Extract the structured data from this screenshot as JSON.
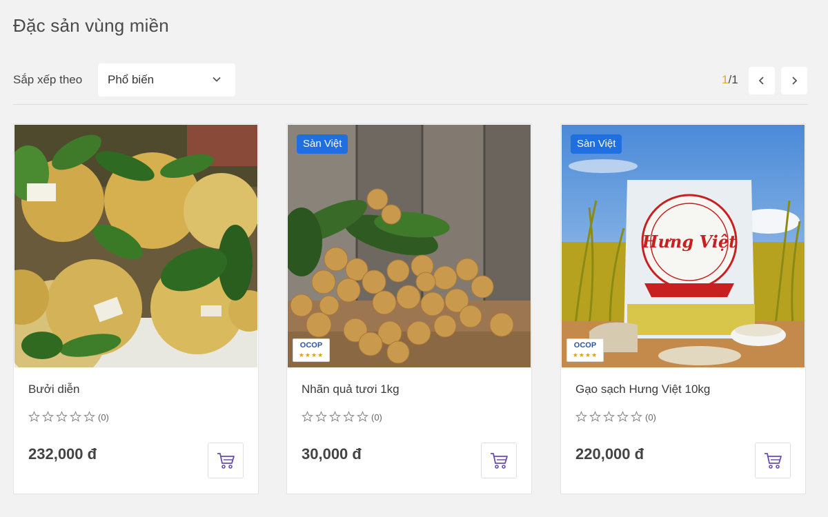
{
  "page_title": "Đặc sản vùng miền",
  "sort": {
    "label": "Sắp xếp theo",
    "selected": "Phổ biến"
  },
  "pagination": {
    "current": "1",
    "total": "/1"
  },
  "products": [
    {
      "name": "Bưởi diễn",
      "price": "232,000 đ",
      "rating_count": "(0)",
      "rating": 0,
      "badge": "",
      "ocop": false,
      "image": "pomelo-photo"
    },
    {
      "name": "Nhãn quả tươi 1kg",
      "price": "30,000 đ",
      "rating_count": "(0)",
      "rating": 0,
      "badge": "Sàn Việt",
      "ocop": true,
      "ocop_label": "OCOP",
      "ocop_stars": "★★★★",
      "image": "longan-photo"
    },
    {
      "name": "Gạo sạch Hưng Việt 10kg",
      "price": "220,000 đ",
      "rating_count": "(0)",
      "rating": 0,
      "badge": "Sàn Việt",
      "ocop": true,
      "ocop_label": "OCOP",
      "ocop_stars": "★★★★",
      "image": "rice-bag-photo",
      "bag_brand": "Hưng Việt"
    }
  ],
  "colors": {
    "badge": "#1f6fe0",
    "pager_current": "#e0a82e",
    "cart_icon": "#6a4bb3"
  }
}
